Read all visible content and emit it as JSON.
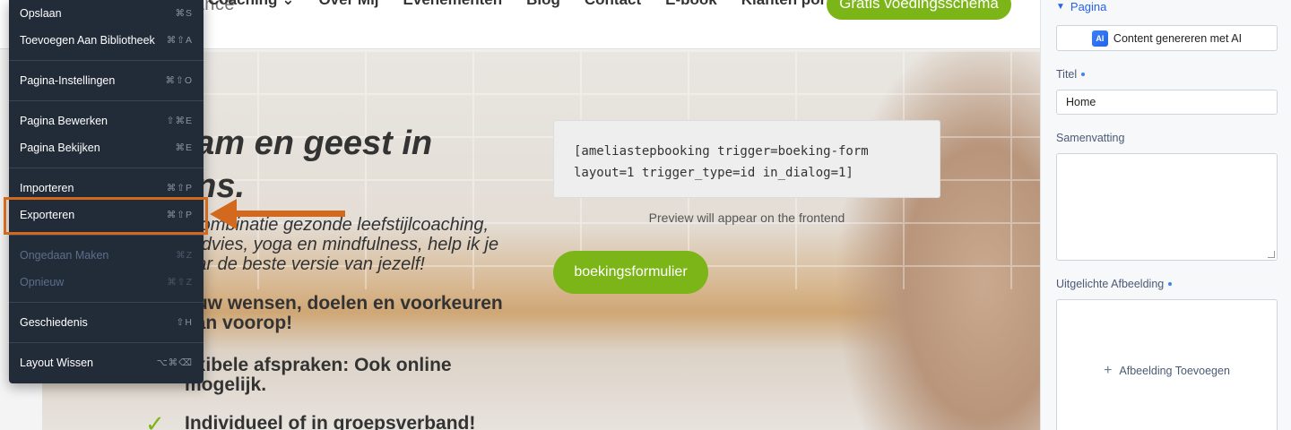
{
  "site": {
    "logo_text": "alance",
    "nav": [
      "Coaching",
      "Over Mij",
      "Evenementen",
      "Blog",
      "Contact",
      "E-book",
      "Klanten portaal"
    ],
    "nav_caret": "⌄",
    "cta_label": "Gratis voedingsschema",
    "hero": {
      "title": "aam en geest in\nans.",
      "intro": "n combinatie gezonde leefstijlcoaching,\nrsadvies, yoga en mindfulness, help ik je\nnaar de beste versie van jezelf!",
      "bullets": [
        "ouw wensen, doelen en voorkeuren\naan voorop!",
        "exibele afspraken: Ook online\nmogelijk.",
        "Individueel of in groepsverband!"
      ],
      "check_glyph": "✓"
    },
    "shortcode_text": "[ameliastepbooking trigger=boeking-form\nlayout=1 trigger_type=id in_dialog=1]",
    "preview_note": "Preview will appear on the frontend",
    "booking_button_label": "boekingsformulier"
  },
  "context_menu": {
    "items": [
      {
        "label": "Opslaan",
        "shortcut": "⌘S",
        "disabled": false
      },
      {
        "label": "Toevoegen Aan Bibliotheek",
        "shortcut": "⌘⇧A",
        "disabled": false
      },
      {
        "label": "Pagina-Instellingen",
        "shortcut": "⌘⇧O",
        "disabled": false
      },
      {
        "label": "Pagina Bewerken",
        "shortcut": "⇧⌘E",
        "disabled": false
      },
      {
        "label": "Pagina Bekijken",
        "shortcut": "⌘E",
        "disabled": false
      },
      {
        "label": "Importeren",
        "shortcut": "⌘⇧P",
        "disabled": false
      },
      {
        "label": "Exporteren",
        "shortcut": "⌘⇧P",
        "disabled": false
      },
      {
        "label": "Ongedaan Maken",
        "shortcut": "⌘Z",
        "disabled": true
      },
      {
        "label": "Opnieuw",
        "shortcut": "⌘⇧Z",
        "disabled": true
      },
      {
        "label": "Geschiedenis",
        "shortcut": "⇧H",
        "disabled": false
      },
      {
        "label": "Layout Wissen",
        "shortcut": "⌥⌘⌫",
        "disabled": false
      }
    ],
    "highlighted_item": "Exporteren",
    "annotation_color": "#d2691e"
  },
  "panel": {
    "section_title": "Pagina",
    "ai_badge": "AI",
    "ai_button_label": "Content genereren met AI",
    "title_label": "Titel",
    "title_value": "Home",
    "summary_label": "Samenvatting",
    "summary_value": "",
    "featured_image_label": "Uitgelichte Afbeelding",
    "add_image_label": "Afbeelding Toevoegen"
  },
  "colors": {
    "accent_green": "#7cb518",
    "menu_bg": "#222b38",
    "panel_link_blue": "#2563eb"
  }
}
